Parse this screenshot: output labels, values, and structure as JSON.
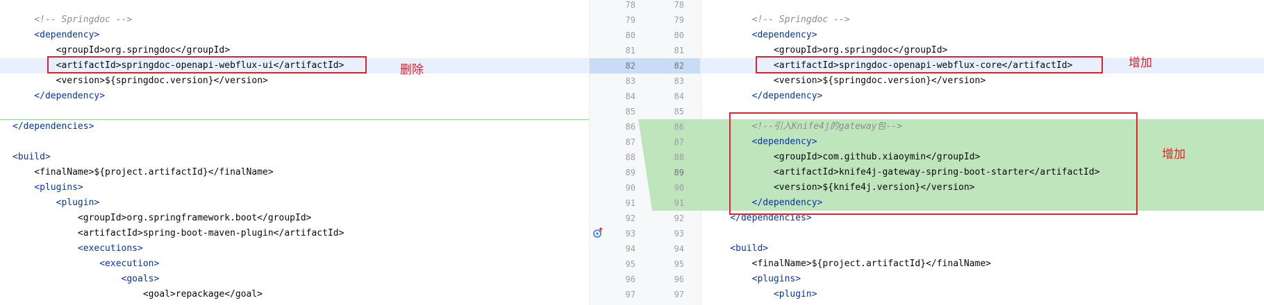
{
  "left": {
    "lines": [
      {
        "n": 78,
        "t": ""
      },
      {
        "n": 79,
        "t": "    <!-- Springdoc -->"
      },
      {
        "n": 80,
        "t": "    <dependency>"
      },
      {
        "n": 81,
        "t": "        <groupId>org.springdoc</groupId>"
      },
      {
        "n": 82,
        "t": "        <artifactId>springdoc-openapi-webflux-ui</artifactId>"
      },
      {
        "n": 83,
        "t": "        <version>${springdoc.version}</version>"
      },
      {
        "n": 84,
        "t": "    </dependency>"
      },
      {
        "n": 85,
        "t": ""
      },
      {
        "n": 86,
        "t": "</dependencies>"
      },
      {
        "n": 87,
        "t": ""
      },
      {
        "n": 88,
        "t": "<build>"
      },
      {
        "n": 89,
        "t": "    <finalName>${project.artifactId}</finalName>"
      },
      {
        "n": 90,
        "t": "    <plugins>"
      },
      {
        "n": 91,
        "t": "        <plugin>"
      },
      {
        "n": 92,
        "t": "            <groupId>org.springframework.boot</groupId>"
      },
      {
        "n": 93,
        "t": "            <artifactId>spring-boot-maven-plugin</artifactId>"
      },
      {
        "n": 94,
        "t": "            <executions>"
      },
      {
        "n": 95,
        "t": "                <execution>"
      },
      {
        "n": 96,
        "t": "                    <goals>"
      },
      {
        "n": 97,
        "t": "                        <goal>repackage</goal>"
      }
    ],
    "annotation": "删除"
  },
  "right": {
    "lines": [
      {
        "n": 78,
        "t": ""
      },
      {
        "n": 79,
        "t": "        <!-- Springdoc -->"
      },
      {
        "n": 80,
        "t": "        <dependency>"
      },
      {
        "n": 81,
        "t": "            <groupId>org.springdoc</groupId>"
      },
      {
        "n": 82,
        "t": "            <artifactId>springdoc-openapi-webflux-core</artifactId>"
      },
      {
        "n": 83,
        "t": "            <version>${springdoc.version}</version>"
      },
      {
        "n": 84,
        "t": "        </dependency>"
      },
      {
        "n": 85,
        "t": ""
      },
      {
        "n": 86,
        "t": "        <!--引入Knife4j的gateway包-->"
      },
      {
        "n": 87,
        "t": "        <dependency>"
      },
      {
        "n": 88,
        "t": "            <groupId>com.github.xiaoymin</groupId>"
      },
      {
        "n": 89,
        "t": "            <artifactId>knife4j-gateway-spring-boot-starter</artifactId>"
      },
      {
        "n": 90,
        "t": "            <version>${knife4j.version}</version>"
      },
      {
        "n": 91,
        "t": "        </dependency>"
      },
      {
        "n": 92,
        "t": "    </dependencies>"
      },
      {
        "n": 93,
        "t": ""
      },
      {
        "n": 94,
        "t": "    <build>"
      },
      {
        "n": 95,
        "t": "        <finalName>${project.artifactId}</finalName>"
      },
      {
        "n": 96,
        "t": "        <plugins>"
      },
      {
        "n": 97,
        "t": "            <plugin>"
      }
    ],
    "annotation_1": "增加",
    "annotation_2": "增加"
  },
  "colors": {
    "changed_line": "#e8f0fe",
    "added_block": "#bfe5bd",
    "annotation_red": "#e0202a",
    "tag_blue": "#0033b3"
  },
  "icons": [
    "implement-override-icon"
  ]
}
